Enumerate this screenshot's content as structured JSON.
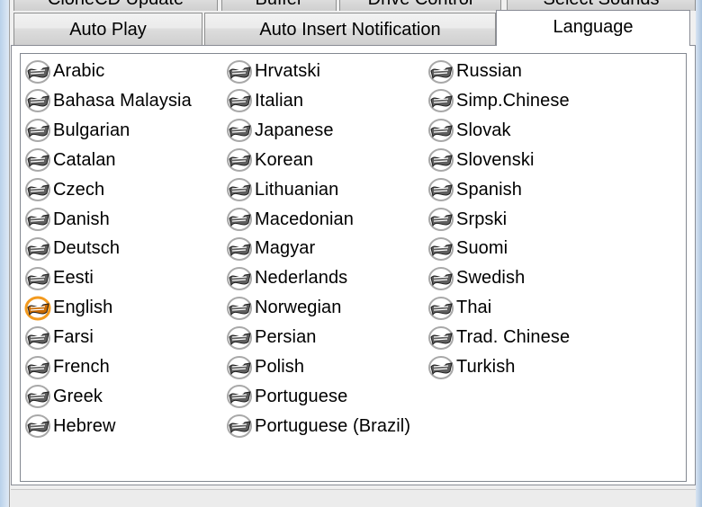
{
  "tabs": {
    "row1": [
      {
        "id": "clonecd-update",
        "label": "CloneCD Update"
      },
      {
        "id": "buffer",
        "label": "Buffer"
      },
      {
        "id": "drive-control",
        "label": "Drive Control"
      },
      {
        "id": "select-sounds",
        "label": "Select Sounds"
      }
    ],
    "row2": [
      {
        "id": "auto-play",
        "label": "Auto Play"
      },
      {
        "id": "auto-insert-notification",
        "label": "Auto Insert Notification"
      },
      {
        "id": "language",
        "label": "Language"
      }
    ],
    "active": "language"
  },
  "languages": {
    "selected": "English",
    "icon": "language-flag-icon",
    "columns": [
      [
        "Arabic",
        "Bahasa Malaysia",
        "Bulgarian",
        "Catalan",
        "Czech",
        "Danish",
        "Deutsch",
        "Eesti",
        "English",
        "Farsi",
        "French",
        "Greek",
        "Hebrew"
      ],
      [
        "Hrvatski",
        "Italian",
        "Japanese",
        "Korean",
        "Lithuanian",
        "Macedonian",
        "Magyar",
        "Nederlands",
        "Norwegian",
        "Persian",
        "Polish",
        "Portuguese",
        "Portuguese (Brazil)"
      ],
      [
        "Russian",
        "Simp.Chinese",
        "Slovak",
        "Slovenski",
        "Spanish",
        "Srpski",
        "Suomi",
        "Swedish",
        "Thai",
        "Trad. Chinese",
        "Turkish"
      ]
    ]
  },
  "colors": {
    "selected_ring": "#f39a1e",
    "icon_ring": "#a8a8a8"
  }
}
